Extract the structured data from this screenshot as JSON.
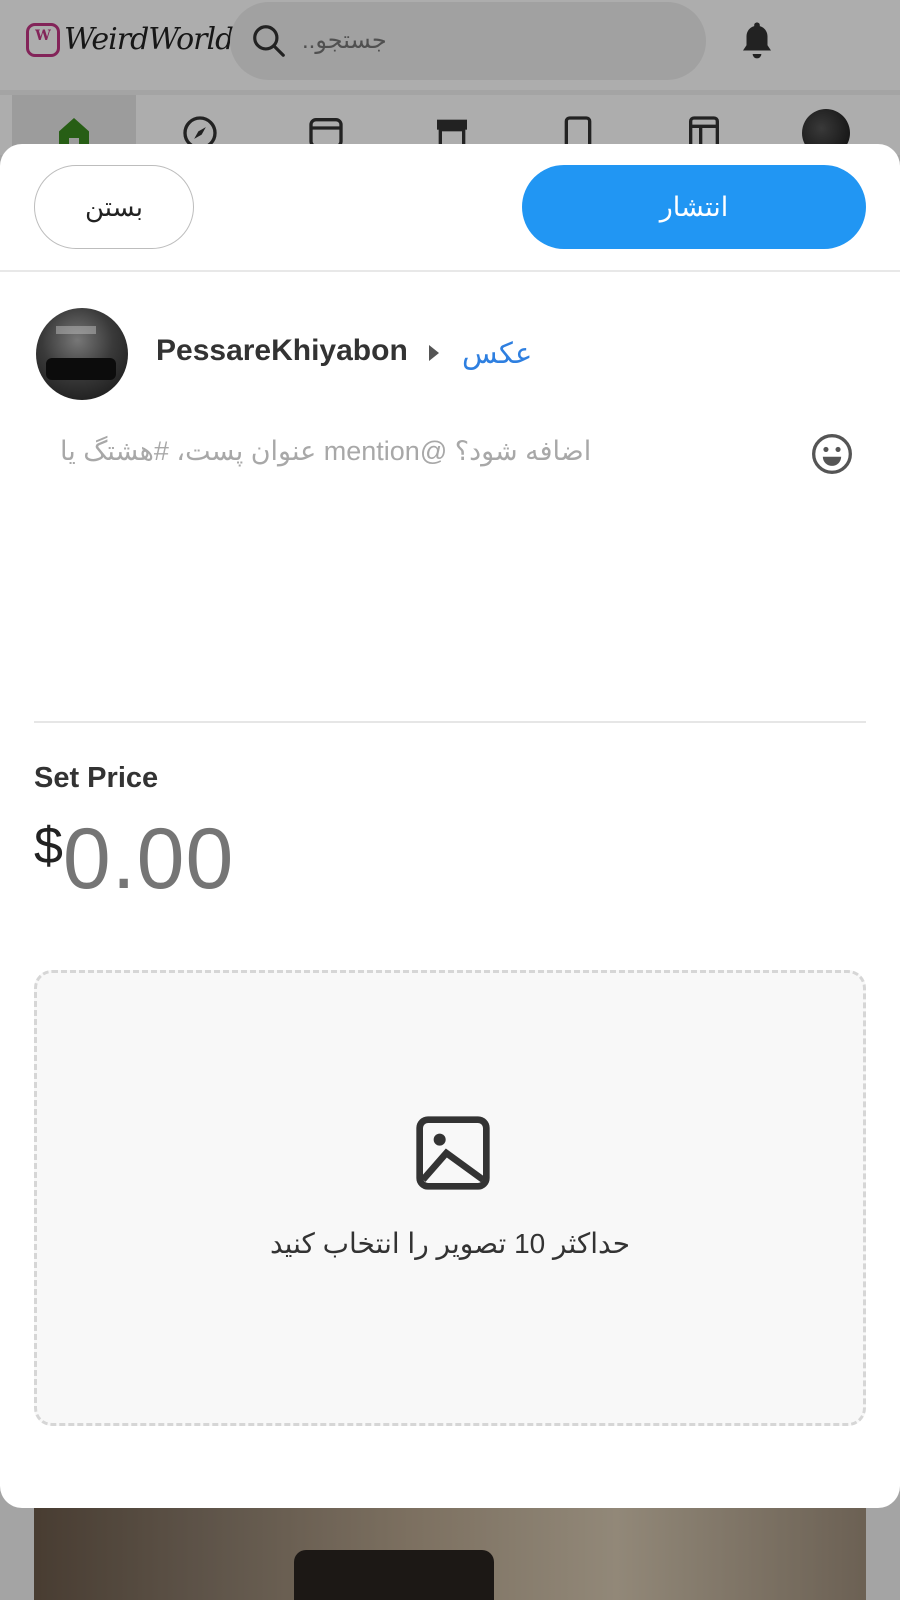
{
  "app": {
    "logo_text": "WeirdWorld",
    "search_placeholder": "جستجو.."
  },
  "nav": {
    "items": [
      "home-icon",
      "explore-icon",
      "reels-icon",
      "store-icon",
      "pages-icon",
      "groups-icon",
      "profile-avatar"
    ],
    "active_color": "#3a8b1f"
  },
  "modal": {
    "close_label": "بستن",
    "publish_label": "انتشار",
    "author_name": "PessareKhiyabon",
    "post_type": "عکس",
    "caption_placeholder": "اضافه شود؟ @mention عنوان پست، #هشتگ یا",
    "price_label": "Set Price",
    "currency": "$",
    "price_value": "0.00",
    "upload_text": "حداکثر 10 تصویر را انتخاب کنید"
  },
  "colors": {
    "primary": "#2196f3",
    "type_link": "#2e7fe0"
  }
}
